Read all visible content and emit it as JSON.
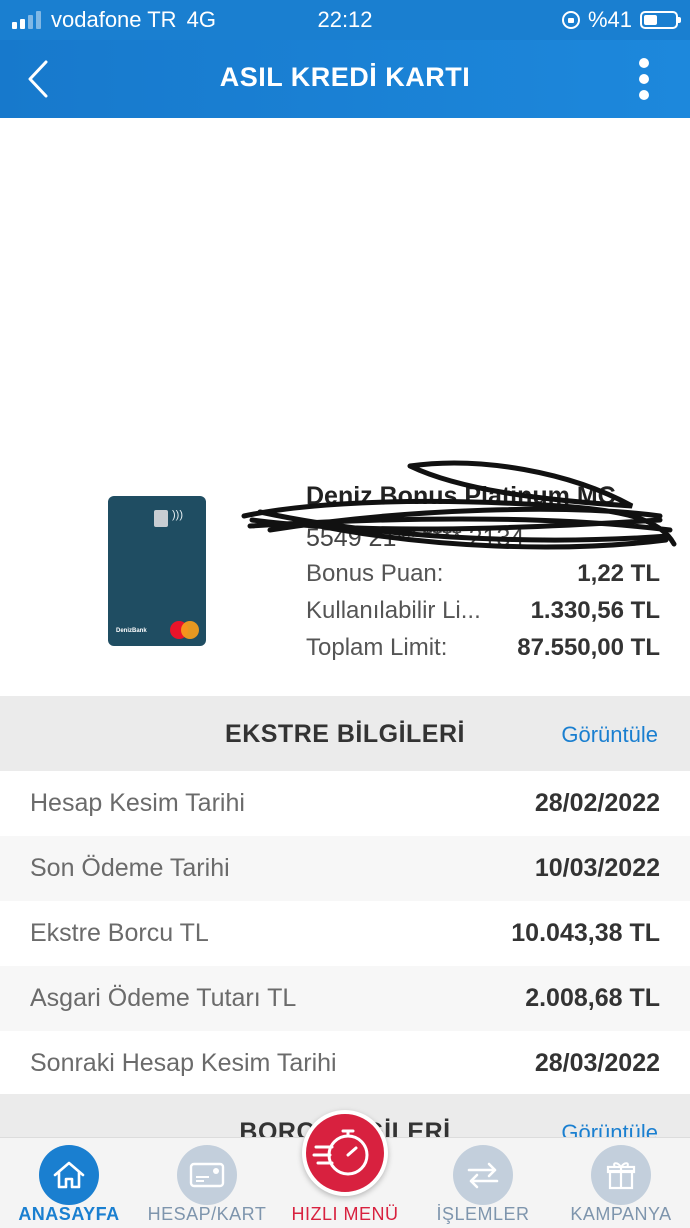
{
  "status": {
    "carrier": "vodafone TR",
    "network": "4G",
    "time": "22:12",
    "battery": "%41"
  },
  "nav": {
    "title": "ASIL KREDİ KARTI"
  },
  "card": {
    "name": "Deniz Bonus Platinum MC",
    "number": "5549 21** **** 2134",
    "brand": "DenizBank",
    "rows": [
      {
        "label": "Bonus Puan:",
        "value": "1,22 TL"
      },
      {
        "label": "Kullanılabilir Li...",
        "value": "1.330,56 TL"
      },
      {
        "label": "Toplam Limit:",
        "value": "87.550,00 TL"
      }
    ]
  },
  "statement": {
    "title": "EKSTRE BİLGİLERİ",
    "link": "Görüntüle",
    "rows": [
      {
        "label": "Hesap Kesim Tarihi",
        "value": "28/02/2022"
      },
      {
        "label": "Son Ödeme Tarihi",
        "value": "10/03/2022"
      },
      {
        "label": "Ekstre Borcu TL",
        "value": "10.043,38 TL"
      },
      {
        "label": "Asgari Ödeme Tutarı TL",
        "value": "2.008,68 TL"
      },
      {
        "label": "Sonraki Hesap Kesim Tarihi",
        "value": "28/03/2022"
      }
    ]
  },
  "debt": {
    "title": "BORÇ BİLGİLERİ",
    "link": "Görüntüle"
  },
  "tabs": [
    {
      "label": "ANASAYFA",
      "icon": "home-icon"
    },
    {
      "label": "HESAP/KART",
      "icon": "card-icon"
    },
    {
      "label": "HIZLI MENÜ",
      "icon": "fast-menu-icon"
    },
    {
      "label": "İŞLEMLER",
      "icon": "transfer-icon"
    },
    {
      "label": "KAMPANYA",
      "icon": "gift-icon"
    }
  ],
  "colors": {
    "primary": "#1a7fd0",
    "accent": "#d8213f",
    "card": "#1f4d62"
  }
}
